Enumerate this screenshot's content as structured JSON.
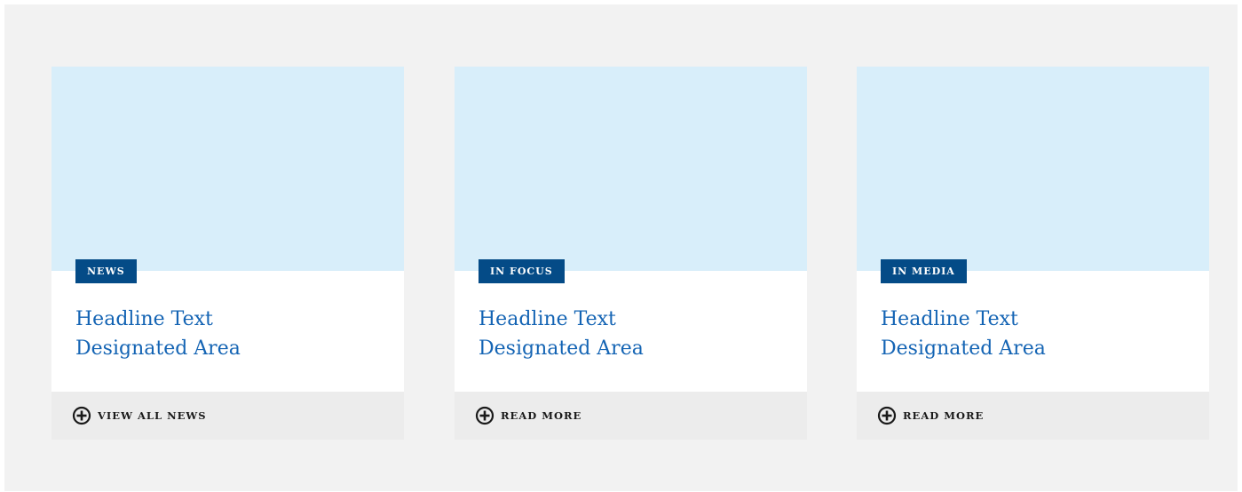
{
  "cards": [
    {
      "tag": "NEWS",
      "headline_line1": "Headline Text",
      "headline_line2": "Designated Area",
      "link_label": "VIEW ALL NEWS",
      "link_icon": "plus-circle-icon"
    },
    {
      "tag": "IN FOCUS",
      "headline_line1": "Headline Text",
      "headline_line2": "Designated Area",
      "link_label": "READ MORE",
      "link_icon": "plus-circle-icon"
    },
    {
      "tag": "IN MEDIA",
      "headline_line1": "Headline Text",
      "headline_line2": "Designated Area",
      "link_label": "READ MORE",
      "link_icon": "plus-circle-icon"
    }
  ],
  "colors": {
    "page_background": "#f2f2f2",
    "image_placeholder": "#d8eefa",
    "tag_background": "#044b87",
    "tag_text": "#ffffff",
    "headline_text": "#1464b4",
    "footer_background": "#ececec",
    "footer_text": "#1a1a1a"
  }
}
